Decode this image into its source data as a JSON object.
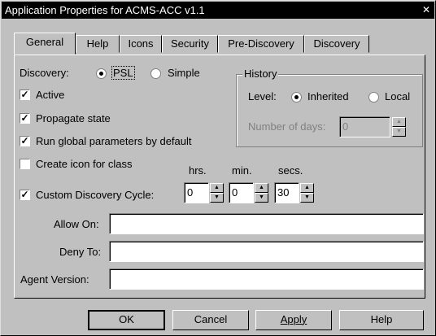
{
  "window": {
    "title": "Application Properties for ACMS-ACC  v1.1",
    "close_glyph": "✕"
  },
  "tabs": [
    {
      "label": "General"
    },
    {
      "label": "Help"
    },
    {
      "label": "Icons"
    },
    {
      "label": "Security"
    },
    {
      "label": "Pre-Discovery"
    },
    {
      "label": "Discovery"
    }
  ],
  "discovery": {
    "label": "Discovery:",
    "options": [
      "PSL",
      "Simple"
    ],
    "selected": "PSL"
  },
  "checkboxes": {
    "active": {
      "label": "Active",
      "checked": true
    },
    "propagate": {
      "label": "Propagate state",
      "checked": true
    },
    "run_global": {
      "label": "Run global parameters by default",
      "checked": true
    },
    "create_icon": {
      "label": "Create icon for class",
      "checked": false
    },
    "custom_cycle": {
      "label": "Custom Discovery Cycle:",
      "checked": true
    }
  },
  "history": {
    "title": "History",
    "level_label": "Level:",
    "options": [
      "Inherited",
      "Local"
    ],
    "selected": "Inherited",
    "days_label": "Number of days:",
    "days_value": "0"
  },
  "cycle": {
    "hrs_label": "hrs.",
    "min_label": "min.",
    "secs_label": "secs.",
    "hrs": "0",
    "min": "0",
    "secs": "30"
  },
  "fields": {
    "allow_on": {
      "label": "Allow On:",
      "value": ""
    },
    "deny_to": {
      "label": "Deny To:",
      "value": ""
    },
    "agent_version": {
      "label": "Agent Version:",
      "value": ""
    }
  },
  "buttons": {
    "ok": "OK",
    "cancel": "Cancel",
    "apply": "Apply",
    "help": "Help"
  }
}
